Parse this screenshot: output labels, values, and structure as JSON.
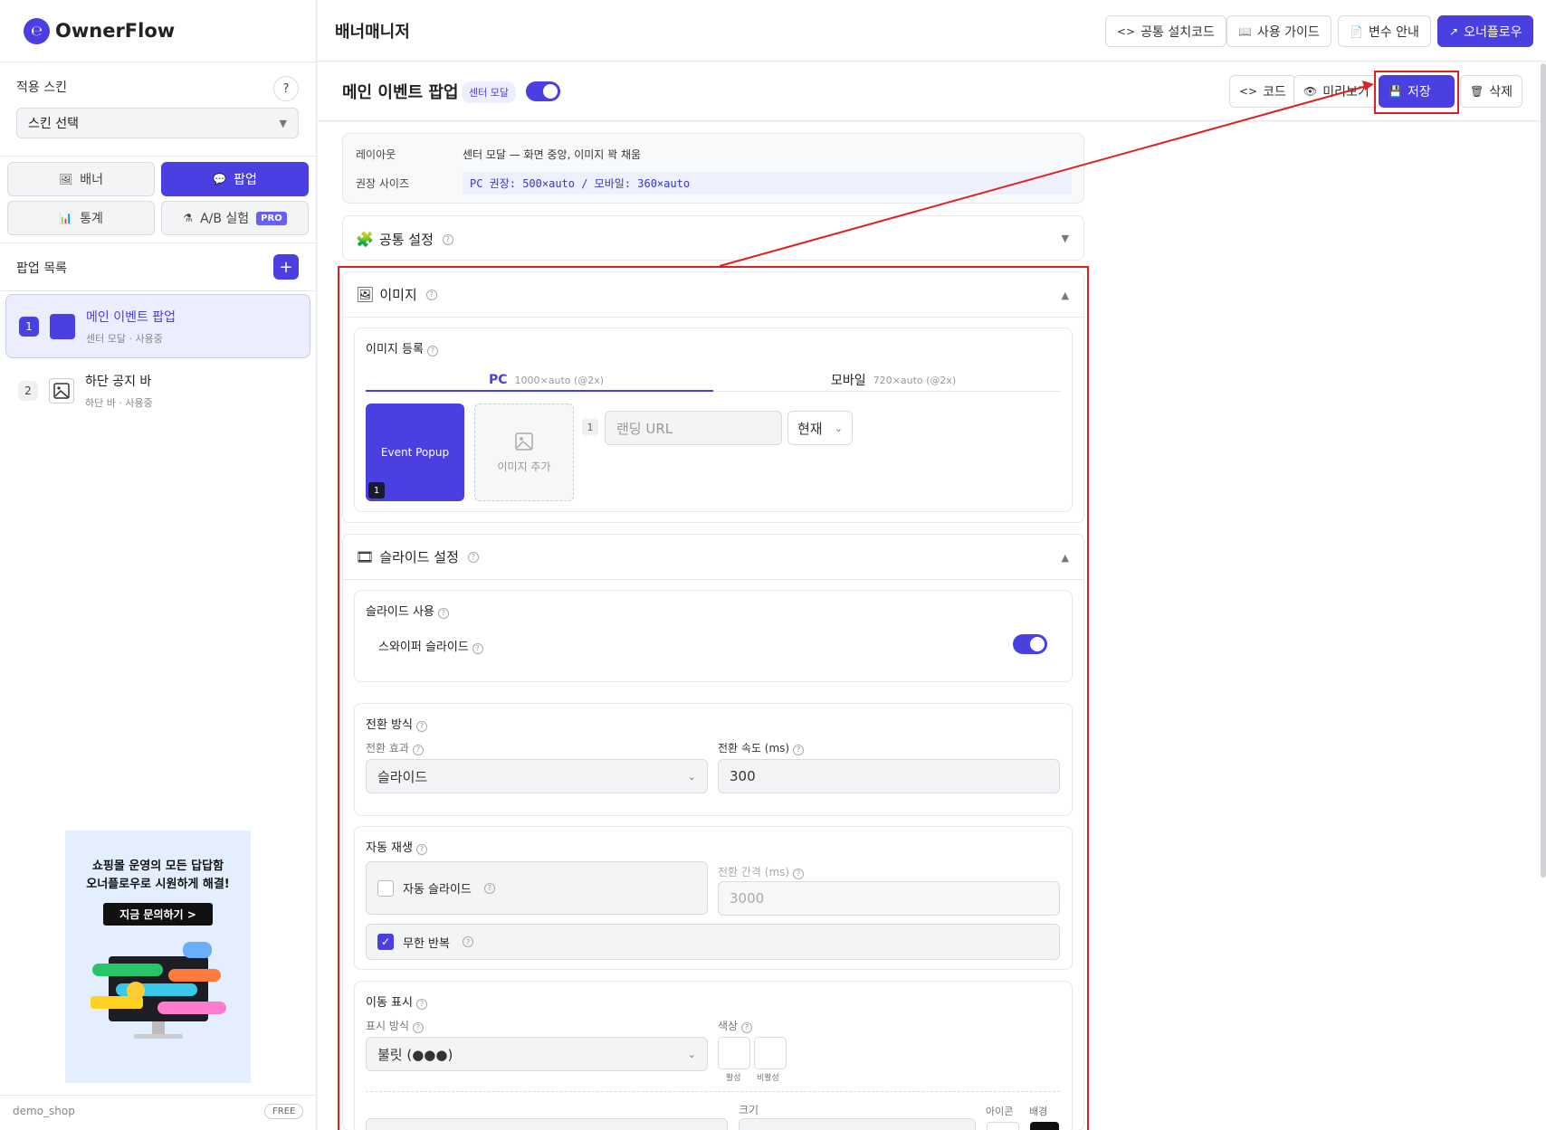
{
  "brand": {
    "name": "OwnerFlow"
  },
  "sidebar": {
    "skin_label": "적용 스킨",
    "help": "?",
    "skin_select": "스킨 선택",
    "nav": {
      "banner": "배너",
      "popup": "팝업",
      "stats": "통계",
      "ab": "A/B 실험",
      "pro": "PRO"
    },
    "list_title": "팝업 목록",
    "add": "+",
    "items": [
      {
        "num": "1",
        "title": "메인 이벤트 팝업",
        "sub": "센터 모달 · 사용중"
      },
      {
        "num": "2",
        "title": "하단 공지 바",
        "sub": "하단 바 · 사용중"
      }
    ],
    "ad": {
      "line1": "쇼핑몰 운영의 모든 답답함",
      "line2": "오너플로우로 시원하게 해결!",
      "cta": "지금 문의하기 >"
    },
    "shop": "demo_shop",
    "plan": "FREE"
  },
  "topbar": {
    "title": "배너매니저",
    "buttons": {
      "install": "공통 설치코드",
      "guide": "사용 가이드",
      "vars": "변수 안내",
      "ownerflow": "오너플로우"
    }
  },
  "subbar": {
    "name": "메인 이벤트 팝업",
    "mode": "센터 모달",
    "buttons": {
      "code": "코드",
      "preview": "미리보기",
      "save": "저장",
      "delete": "삭제"
    }
  },
  "info": {
    "layout_label": "레이아웃",
    "layout_value": "센터 모달 — 화면 중앙, 이미지 꽉 채움",
    "size_label": "권장 사이즈",
    "size_value": "PC 권장: 500×auto / 모바일: 360×auto"
  },
  "sections": {
    "common": "공통 설정",
    "image": "이미지",
    "slide": "슬라이드 설정"
  },
  "image": {
    "register": "이미지 등록",
    "tab_pc": "PC",
    "tab_pc_sub": "1000×auto (@2x)",
    "tab_mobile": "모바일",
    "tab_mobile_sub": "720×auto (@2x)",
    "thumb_label": "Event Popup",
    "thumb_num": "1",
    "add_image": "이미지 추가",
    "row_num": "1",
    "landing_placeholder": "랜딩 URL",
    "target": "현재"
  },
  "slide": {
    "use_label": "슬라이드 사용",
    "swiper": "스와이퍼 슬라이드",
    "transition_title": "전환 방식",
    "effect_label": "전환 효과",
    "effect_value": "슬라이드",
    "speed_label": "전환 속도 (ms)",
    "speed_value": "300",
    "autoplay_title": "자동 재생",
    "auto_slide": "자동 슬라이드",
    "interval_label": "전환 간격 (ms)",
    "interval_value": "3000",
    "loop": "무한 반복",
    "nav_title": "이동 표시",
    "display_label": "표시 방식",
    "display_value": "불릿 (●●●)",
    "color_label": "색상",
    "active": "활성",
    "inactive": "비활성",
    "size_label": "크기",
    "icon_label": "아이콘",
    "bg_label": "배경"
  },
  "colors": {
    "accent": "#4a3fe0",
    "highlight": "#e02020"
  }
}
